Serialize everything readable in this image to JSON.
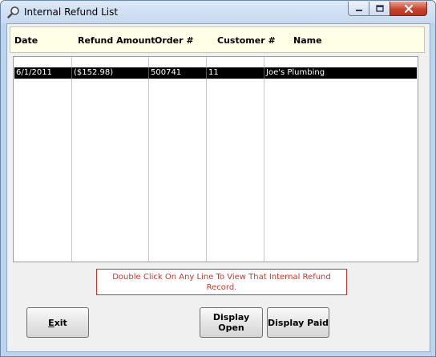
{
  "window": {
    "title": "Internal Refund List",
    "icon": "magnifier-icon"
  },
  "header": {
    "date": "Date",
    "refund_amount": "Refund Amount",
    "order": "Order #",
    "customer": "Customer #",
    "name": "Name"
  },
  "rows": [
    {
      "date": "6/1/2011",
      "refund_amount": "($152.98)",
      "order": "500741",
      "customer": "11",
      "name": "Joe's Plumbing"
    }
  ],
  "notice": {
    "text": "Double Click On Any Line To View That Internal Refund Record."
  },
  "buttons": {
    "exit_mnemonic": "E",
    "exit_rest": "xit",
    "display_open_line1": "Display",
    "display_open_line2": "Open",
    "display_paid": "Display Paid"
  },
  "colors": {
    "notice": "#d2332a",
    "selected_row": "#000000",
    "header_panel": "#ffffe7"
  }
}
